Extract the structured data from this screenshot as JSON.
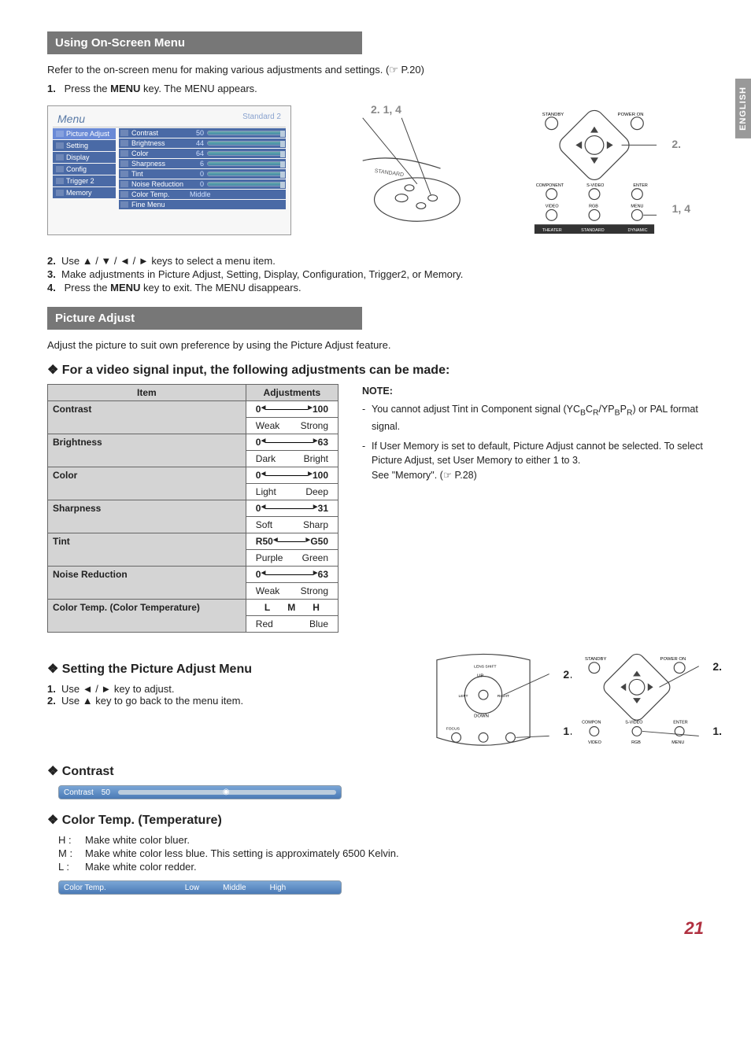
{
  "lang_tab": "ENGLISH",
  "sec1_title": "Using On-Screen Menu",
  "sec1_intro": "Refer to the on-screen menu for making various adjustments and settings. (☞ P.20)",
  "sec1_step1_pre": "Press the ",
  "sec1_step1_bold": "MENU",
  "sec1_step1_post": " key. The MENU appears.",
  "menu": {
    "title": "Menu",
    "standard": "Standard 2",
    "left": [
      "Picture Adjust",
      "Setting",
      "Display",
      "Config",
      "Trigger 2",
      "Memory"
    ],
    "right": [
      {
        "label": "Contrast",
        "val": "50"
      },
      {
        "label": "Brightness",
        "val": "44"
      },
      {
        "label": "Color",
        "val": "64"
      },
      {
        "label": "Sharpness",
        "val": "6"
      },
      {
        "label": "Tint",
        "val": "0"
      },
      {
        "label": "Noise Reduction",
        "val": "0"
      },
      {
        "label": "Color Temp.",
        "val": "Middle"
      },
      {
        "label": "Fine Menu",
        "val": ""
      }
    ]
  },
  "illus1_callouts": {
    "proj_top": "2.    1, 4",
    "remote_right_top": "2.",
    "remote_right_bot": "1, 4"
  },
  "sec1_step2": "Use ▲ / ▼ / ◄ / ► keys to select a menu item.",
  "sec1_step3": "Make adjustments in Picture Adjust, Setting, Display, Configuration, Trigger2, or Memory.",
  "sec1_step4_pre": "Press the ",
  "sec1_step4_bold": "MENU",
  "sec1_step4_post": " key to exit. The MENU disappears.",
  "sec2_title": "Picture Adjust",
  "sec2_intro": "Adjust the picture to suit own preference by using the Picture Adjust feature.",
  "sec2_sub": "For a video signal input, the following adjustments can be made:",
  "table": {
    "h_item": "Item",
    "h_adj": "Adjustments",
    "rows": [
      {
        "item": "Contrast",
        "lo": "0",
        "hi": "100",
        "lolab": "Weak",
        "hilab": "Strong"
      },
      {
        "item": "Brightness",
        "lo": "0",
        "hi": "63",
        "lolab": "Dark",
        "hilab": "Bright"
      },
      {
        "item": "Color",
        "lo": "0",
        "hi": "100",
        "lolab": "Light",
        "hilab": "Deep"
      },
      {
        "item": "Sharpness",
        "lo": "0",
        "hi": "31",
        "lolab": "Soft",
        "hilab": "Sharp"
      },
      {
        "item": "Tint",
        "lo": "R50",
        "hi": "G50",
        "lolab": "Purple",
        "hilab": "Green"
      },
      {
        "item": "Noise Reduction",
        "lo": "0",
        "hi": "63",
        "lolab": "Weak",
        "hilab": "Strong"
      }
    ],
    "ct_item": "Color Temp. (Color Temperature)",
    "ct_l": "L",
    "ct_m": "M",
    "ct_h": "H",
    "ct_lolab": "Red",
    "ct_hilab": "Blue"
  },
  "note": {
    "title": "NOTE:",
    "n1a": "You cannot adjust Tint in Component signal (YC",
    "n1b": "B",
    "n1c": "C",
    "n1d": "R",
    "n1e": "/YP",
    "n1f": "B",
    "n1g": "P",
    "n1h": "R",
    "n1i": ") or PAL format signal.",
    "n2": "If User Memory is set to default, Picture Adjust cannot be selected. To select Picture Adjust, set User Memory to either 1 to 3.",
    "n3": "See \"Memory\". (☞ P.28)"
  },
  "sec3_sub": "Setting the Picture Adjust Menu",
  "sec3_step1": "Use ◄ / ► key to adjust.",
  "sec3_step2": "Use ▲ key to go back to the menu item.",
  "illus2_callouts": {
    "diag_top": "2.",
    "diag_bot": "1.",
    "remote_top": "2.",
    "remote_bot": "1."
  },
  "sec4_sub": "Contrast",
  "contrast_bar": {
    "label": "Contrast",
    "value": "50"
  },
  "sec5_sub": "Color Temp. (Temperature)",
  "ct_desc": [
    {
      "k": "H :",
      "v": "Make white color bluer."
    },
    {
      "k": "M :",
      "v": "Make white color less blue. This setting is approximately 6500 Kelvin."
    },
    {
      "k": "L :",
      "v": "Make white color redder."
    }
  ],
  "ct_bar": {
    "label": "Color Temp.",
    "low": "Low",
    "mid": "Middle",
    "high": "High"
  },
  "remote_labels": {
    "standby": "STANDBY",
    "poweron": "POWER ON",
    "component": "COMPONENT",
    "svideo": "S-VIDEO",
    "enter": "ENTER",
    "video": "VIDEO",
    "rgb": "RGB",
    "menu": "MENU",
    "theater": "THEATER",
    "standard": "STANDARD",
    "dynamic": "DYNAMIC",
    "compon": "COMPON"
  },
  "page_number": "21"
}
